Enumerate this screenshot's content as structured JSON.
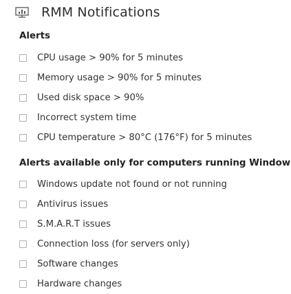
{
  "header": {
    "title": "RMM Notifications",
    "icon": "monitor-chart-icon"
  },
  "sections": [
    {
      "title": "Alerts",
      "items": [
        {
          "label": "CPU usage > 90% for 5 minutes",
          "checked": false
        },
        {
          "label": "Memory usage > 90% for 5 minutes",
          "checked": false
        },
        {
          "label": "Used disk space > 90%",
          "checked": false
        },
        {
          "label": "Incorrect system time",
          "checked": false
        },
        {
          "label": "CPU temperature > 80°C (176°F) for 5 minutes",
          "checked": false
        }
      ]
    },
    {
      "title": "Alerts available only for computers running Windows",
      "items": [
        {
          "label": "Windows update not found or not running",
          "checked": false
        },
        {
          "label": "Antivirus issues",
          "checked": false
        },
        {
          "label": "S.M.A.R.T issues",
          "checked": false
        },
        {
          "label": "Connection loss (for servers only)",
          "checked": false
        },
        {
          "label": "Software changes",
          "checked": false
        },
        {
          "label": "Hardware changes",
          "checked": false
        }
      ]
    }
  ]
}
